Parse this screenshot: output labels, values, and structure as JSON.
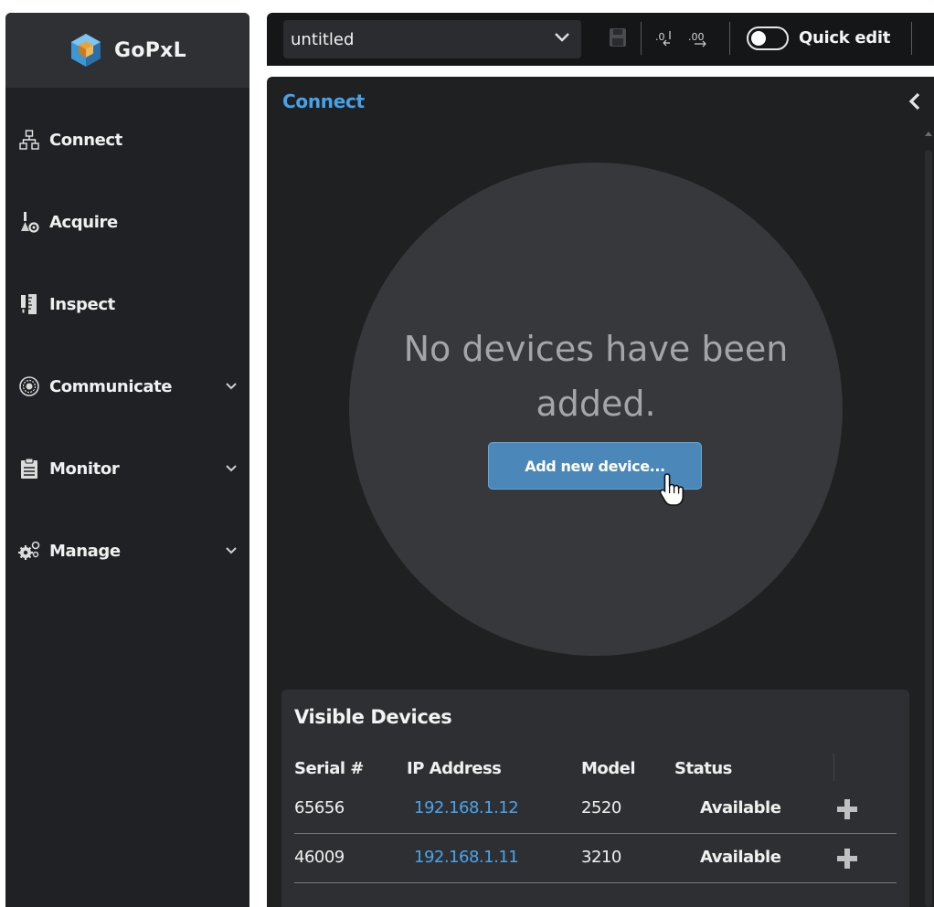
{
  "app": {
    "name": "GoPxL"
  },
  "sidebar": {
    "items": [
      {
        "label": "Connect",
        "icon": "network-icon",
        "expandable": false
      },
      {
        "label": "Acquire",
        "icon": "acquire-icon",
        "expandable": false
      },
      {
        "label": "Inspect",
        "icon": "inspect-icon",
        "expandable": false
      },
      {
        "label": "Communicate",
        "icon": "communicate-icon",
        "expandable": true
      },
      {
        "label": "Monitor",
        "icon": "clipboard-icon",
        "expandable": true
      },
      {
        "label": "Manage",
        "icon": "gears-icon",
        "expandable": true
      }
    ]
  },
  "toolbar": {
    "file_value": "untitled",
    "quick_edit_label": "Quick edit",
    "quick_edit_on": false
  },
  "panel": {
    "title": "Connect",
    "empty_message": "No devices have been added.",
    "add_button_label": "Add new device...",
    "devices": {
      "title": "Visible Devices",
      "columns": [
        "Serial #",
        "IP Address",
        "Model",
        "Status"
      ],
      "rows": [
        {
          "serial": "65656",
          "ip": "192.168.1.12",
          "model": "2520",
          "status": "Available"
        },
        {
          "serial": "46009",
          "ip": "192.168.1.11",
          "model": "3210",
          "status": "Available"
        }
      ]
    }
  },
  "colors": {
    "accent": "#47a2ea",
    "button": "#4b87b9",
    "sidebar_bg": "#202124",
    "panel_bg": "#1f2022"
  }
}
